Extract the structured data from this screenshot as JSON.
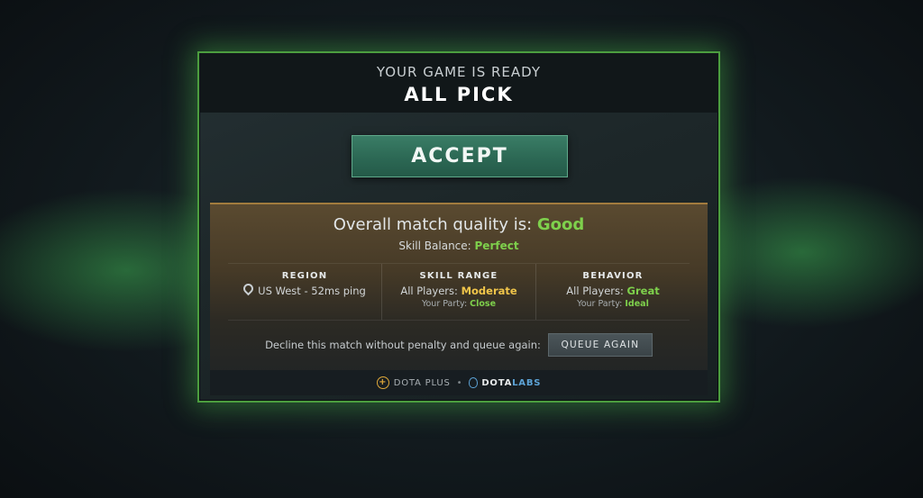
{
  "dialog": {
    "subtitle": "YOUR GAME IS READY",
    "title": "ALL PICK",
    "accept_label": "ACCEPT"
  },
  "quality": {
    "prefix": "Overall match quality is: ",
    "value": "Good",
    "balance_prefix": "Skill Balance: ",
    "balance_value": "Perfect"
  },
  "stats": {
    "region": {
      "title": "REGION",
      "value": "US West - 52ms ping",
      "icon": "location-pin-icon"
    },
    "skill": {
      "title": "SKILL RANGE",
      "players_prefix": "All Players: ",
      "players_value": "Moderate",
      "party_prefix": "Your Party: ",
      "party_value": "Close"
    },
    "behavior": {
      "title": "BEHAVIOR",
      "players_prefix": "All Players: ",
      "players_value": "Great",
      "party_prefix": "Your Party: ",
      "party_value": "Ideal"
    }
  },
  "decline": {
    "text": "Decline this match without penalty and queue again:",
    "button_label": "QUEUE AGAIN"
  },
  "footer": {
    "plus_label": "DOTA PLUS",
    "separator": "•",
    "labs_brand": "DOTA",
    "labs_accent": "LABS"
  },
  "colors": {
    "good": "#7ed04c",
    "moderate": "#f0c54a",
    "accept": "#2c6854",
    "glow": "#4c9e3f"
  }
}
